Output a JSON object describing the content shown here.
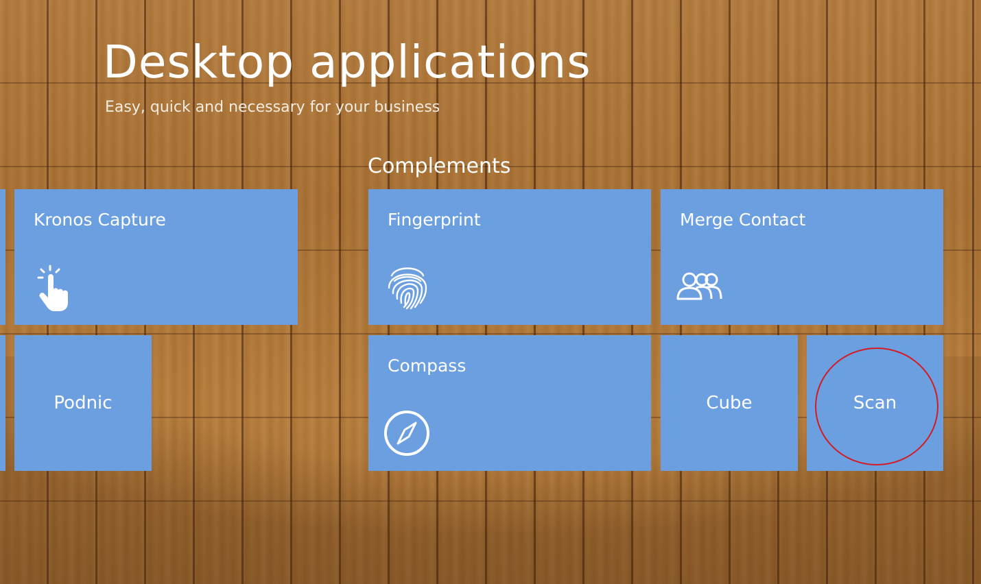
{
  "header": {
    "title": "Desktop applications",
    "subtitle": "Easy, quick and necessary for your business"
  },
  "group": {
    "title": "Complements"
  },
  "tiles": {
    "kronos_capture": {
      "label": "Kronos Capture",
      "icon": "touch-hand-icon"
    },
    "podnic": {
      "label": "Podnic"
    },
    "fingerprint": {
      "label": "Fingerprint",
      "icon": "fingerprint-icon"
    },
    "compass": {
      "label": "Compass",
      "icon": "compass-icon"
    },
    "merge_contact": {
      "label": "Merge Contact",
      "icon": "people-group-icon"
    },
    "cube": {
      "label": "Cube"
    },
    "scan": {
      "label": "Scan"
    }
  },
  "colors": {
    "tile": "#6b9fe0",
    "text": "#ffffff",
    "highlight": "#d21c22"
  }
}
